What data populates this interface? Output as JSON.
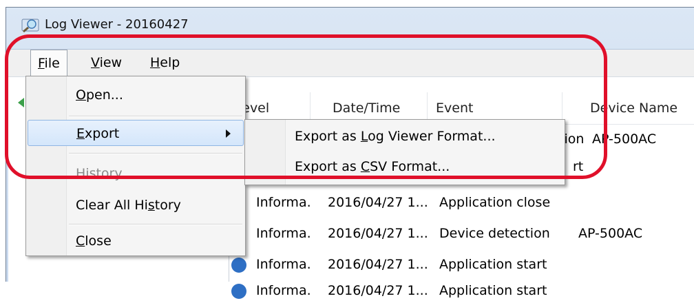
{
  "window": {
    "title": "Log Viewer - 20160427"
  },
  "menubar": {
    "file_pre": "",
    "file_u": "F",
    "file_post": "ile",
    "view_pre": "",
    "view_u": "V",
    "view_post": "iew",
    "help_pre": "",
    "help_u": "H",
    "help_post": "elp"
  },
  "grid": {
    "headers": {
      "level": "Level",
      "datetime": "Date/Time",
      "event": "Event",
      "device": "Device Name"
    },
    "rows": [
      {
        "level": "",
        "datetime": "",
        "event": "tion",
        "device": "AP-500AC"
      },
      {
        "level": "",
        "datetime": "",
        "event": "rt",
        "device": ""
      },
      {
        "level": "Informa.",
        "datetime": "2016/04/27 1...",
        "event": "Application close",
        "device": ""
      },
      {
        "level": "Informa.",
        "datetime": "2016/04/27 1...",
        "event": "Device detection",
        "device": "AP-500AC"
      },
      {
        "level": "Informa.",
        "datetime": "2016/04/27 1...",
        "event": "Application start",
        "device": ""
      },
      {
        "level": "Informa.",
        "datetime": "2016/04/27 1...",
        "event": "Application start",
        "device": ""
      }
    ]
  },
  "file_menu": {
    "open_u": "O",
    "open_post": "pen...",
    "export_u": "E",
    "export_post": "xport",
    "history_u": "H",
    "history_post": "istory",
    "clear_pre": "Clear All Hi",
    "clear_u": "s",
    "clear_post": "tory",
    "close_u": "C",
    "close_post": "lose"
  },
  "export_submenu": {
    "lv_pre": "Export as ",
    "lv_u": "L",
    "lv_post": "og Viewer Format...",
    "csv_pre": "Export as ",
    "csv_u": "C",
    "csv_post": "SV Format..."
  },
  "colors": {
    "highlight_ring": "#e0102a",
    "hover_item": "#d4e6fb"
  }
}
